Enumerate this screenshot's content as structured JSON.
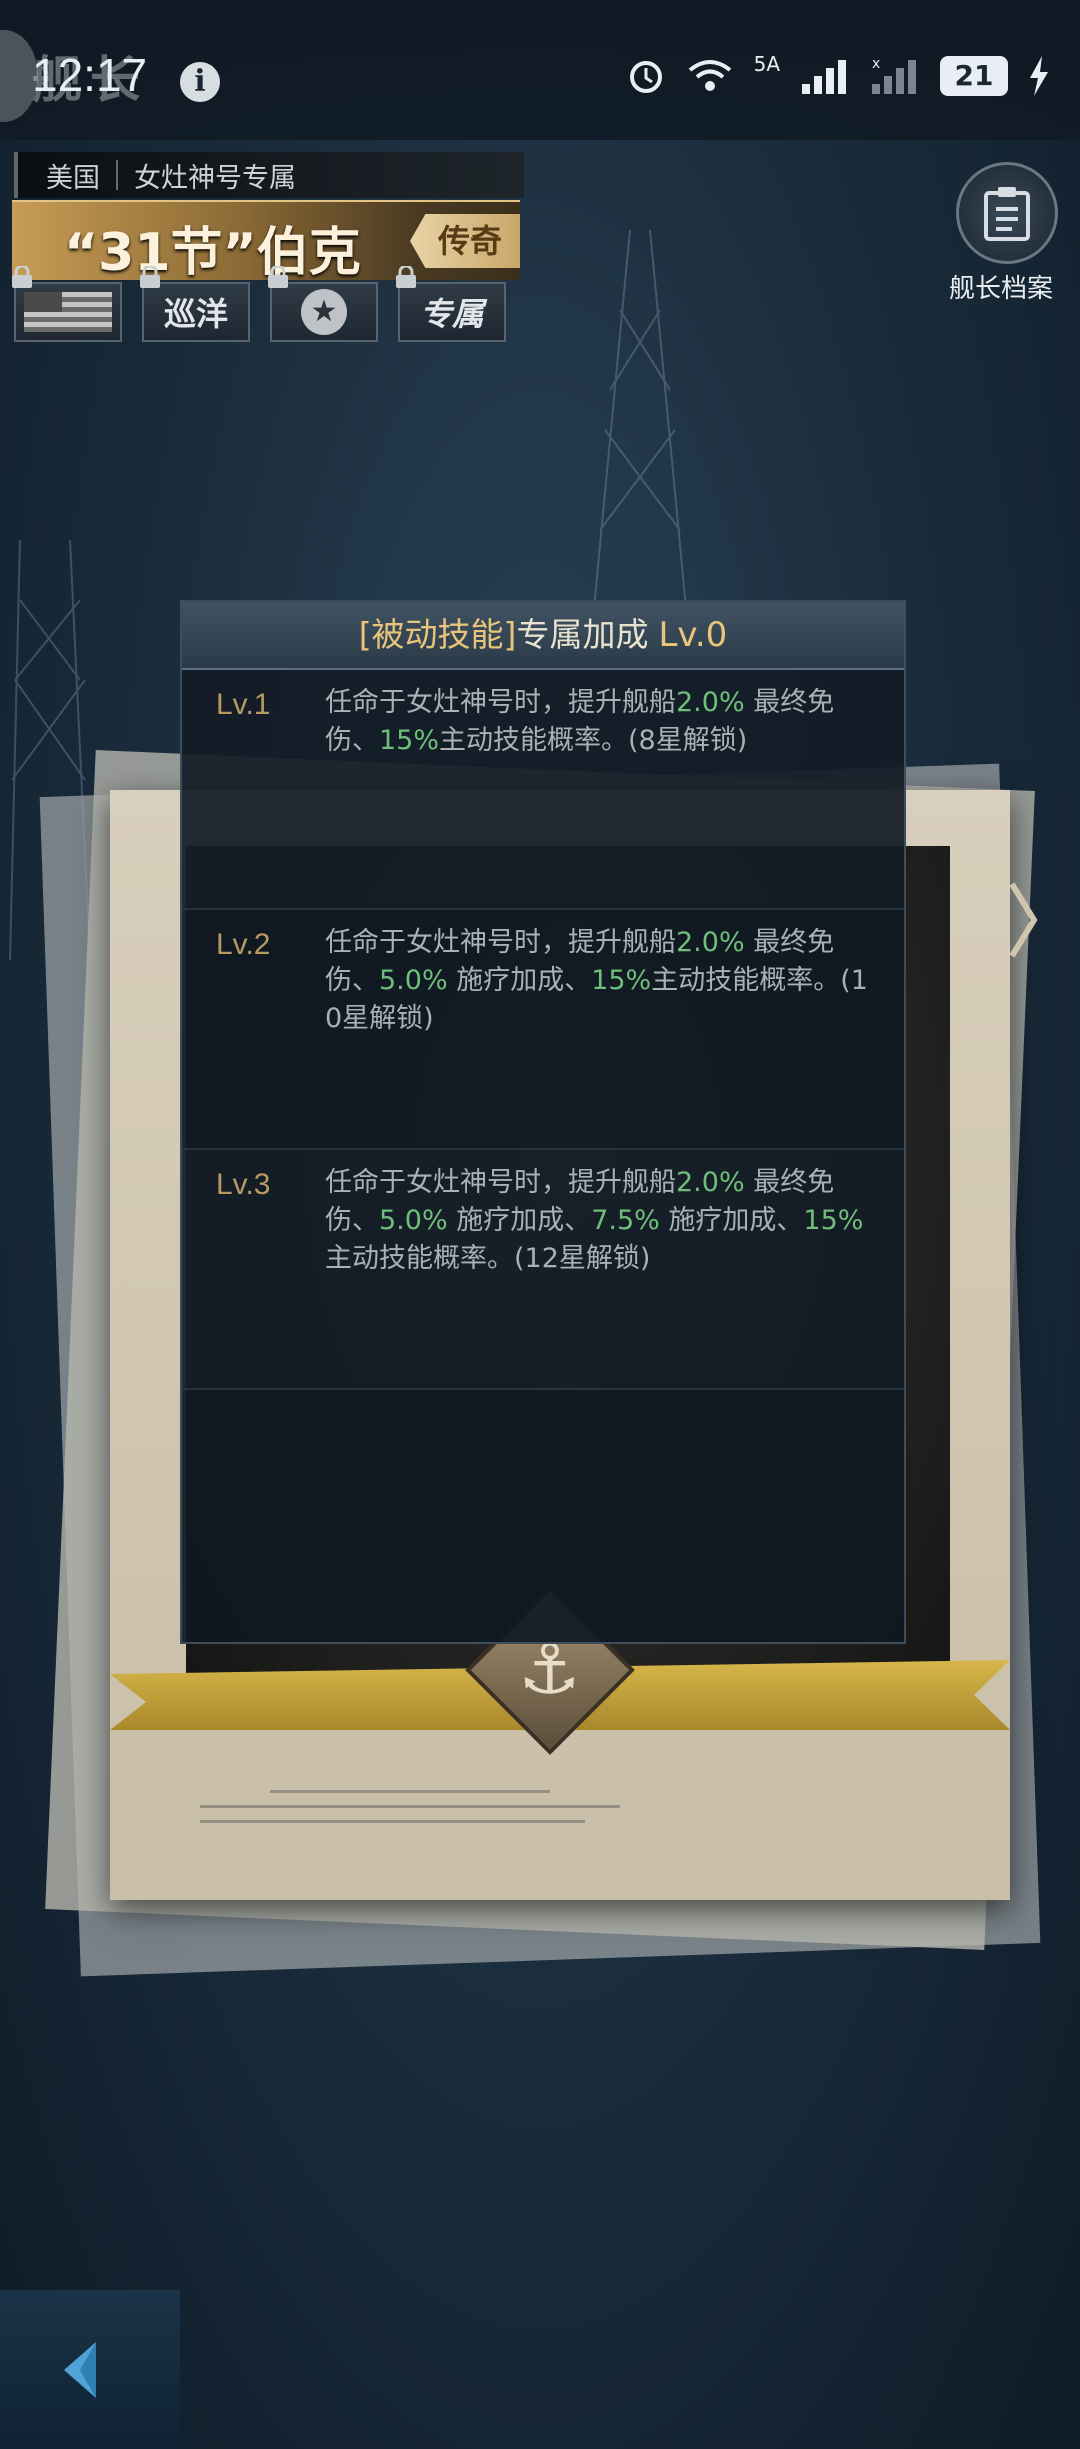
{
  "status_bar": {
    "ghost_title": "舰长",
    "time": "12:17",
    "network": "5A",
    "battery": "21"
  },
  "header": {
    "nation": "美国",
    "exclusive": "女灶神号专属",
    "name": "“31节”伯克",
    "rarity": "传奇",
    "tags": [
      "巡洋",
      "专属"
    ]
  },
  "archive": {
    "label": "舰长档案"
  },
  "skill_panel": {
    "title_prefix": "[被动技能]",
    "title_main": "专属加成",
    "level": "Lv.0",
    "skills": [
      {
        "level": "Lv.1",
        "t1": "任命于女灶神号时，提升舰船",
        "v1": "2.0%",
        "t2": "最终免伤、",
        "v2": "15%",
        "t3": "主动技能概率。(8星解锁)"
      },
      {
        "level": "Lv.2",
        "t1": "任命于女灶神号时，提升舰船",
        "v1": "2.0%",
        "t2": "最终免伤、",
        "v2": "5.0%",
        "t3": "施疗加成、",
        "v3": "15%",
        "t4": "主动技能概率。(10星解锁)"
      },
      {
        "level": "Lv.3",
        "t1": "任命于女灶神号时，提升舰船",
        "v1": "2.0%",
        "t2": "最终免伤、",
        "v2": "5.0%",
        "t3": "施疗加成、",
        "v3": "7.5%",
        "t4": "施疗加成、",
        "v4": "15%",
        "t5": "主动技能概率。(12星解锁)"
      }
    ]
  },
  "colors": {
    "highlight_green": "#6fbf7a",
    "gold": "#e8c57a",
    "level_label": "#b59a62"
  }
}
